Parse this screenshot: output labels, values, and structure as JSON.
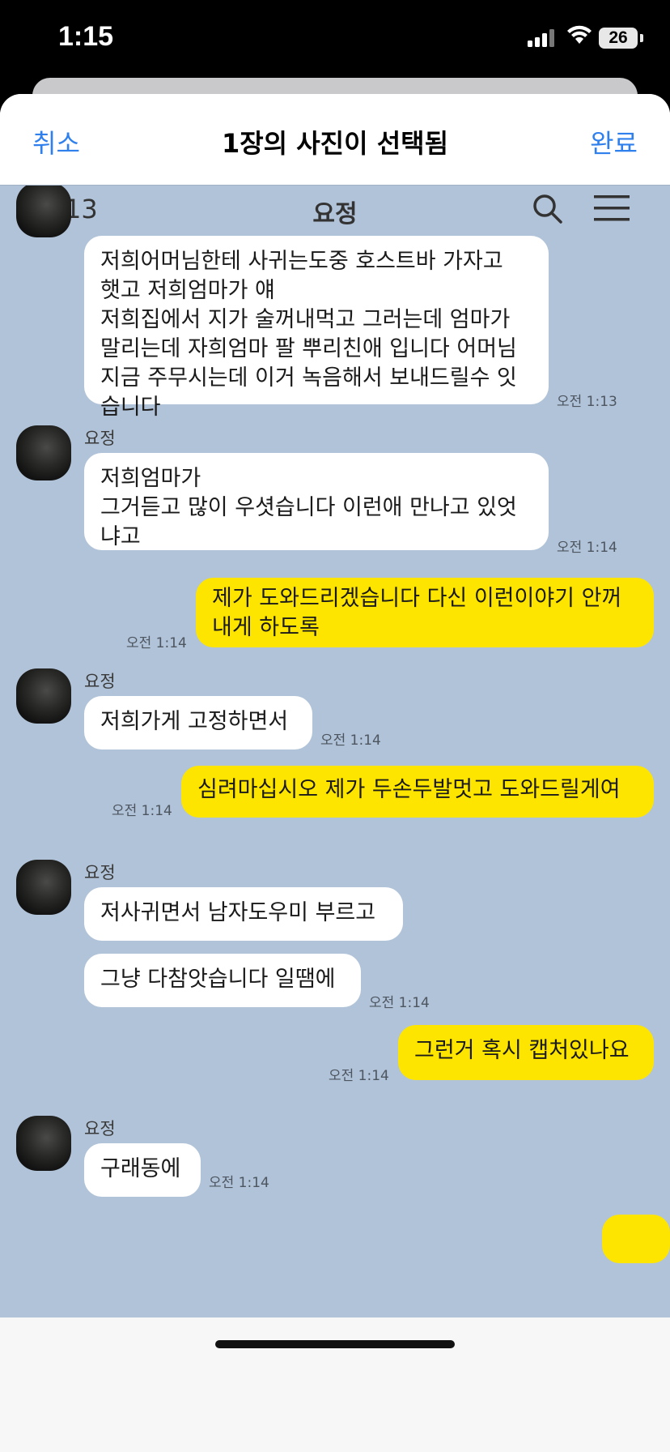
{
  "status_bar": {
    "time": "1:15",
    "battery": "26"
  },
  "sheet": {
    "cancel": "취소",
    "title": "1장의 사진이 선택됨",
    "done": "완료"
  },
  "chat": {
    "back_count": "13",
    "chat_name": "요정",
    "messages": [
      {
        "sender": "",
        "type": "in",
        "lines": [
          "저희어머님한테 사귀는도중 호스트바 가자고",
          "햇고 저희엄마가 얘",
          "저희집에서 지가 술꺼내먹고 그러는데 엄마가",
          "말리는데 자희엄마 팔 뿌리친애 입니다 어머님",
          "지금 주무시는데 이거 녹음해서 보내드릴수 잇",
          "습니다"
        ],
        "time": "오전 1:13"
      },
      {
        "sender": "요정",
        "type": "in",
        "lines": [
          "저희엄마가",
          "그거듣고 많이 우셧습니다 이런애 만나고 있엇",
          "냐고"
        ],
        "time": "오전 1:14"
      },
      {
        "sender": "",
        "type": "out",
        "lines": [
          "제가 도와드리겠습니다 다신 이런이야기 안꺼",
          "내게 하도록"
        ],
        "time": "오전 1:14"
      },
      {
        "sender": "요정",
        "type": "in",
        "lines": [
          "저희가게 고정하면서"
        ],
        "time": "오전 1:14"
      },
      {
        "sender": "",
        "type": "out",
        "lines": [
          "심려마십시오 제가 두손두발멋고 도와드릴게여"
        ],
        "time": "오전 1:14"
      },
      {
        "sender": "요정",
        "type": "in",
        "lines": [
          "저사귀면서 남자도우미 부르고"
        ],
        "time": ""
      },
      {
        "sender": "",
        "type": "in",
        "lines": [
          "그냥 다참앗습니다 일땜에"
        ],
        "time": "오전 1:14"
      },
      {
        "sender": "",
        "type": "out",
        "lines": [
          "그런거 혹시 캡처있나요"
        ],
        "time": "오전 1:14"
      },
      {
        "sender": "요정",
        "type": "in",
        "lines": [
          "구래동에"
        ],
        "time": "오전 1:14"
      }
    ]
  }
}
